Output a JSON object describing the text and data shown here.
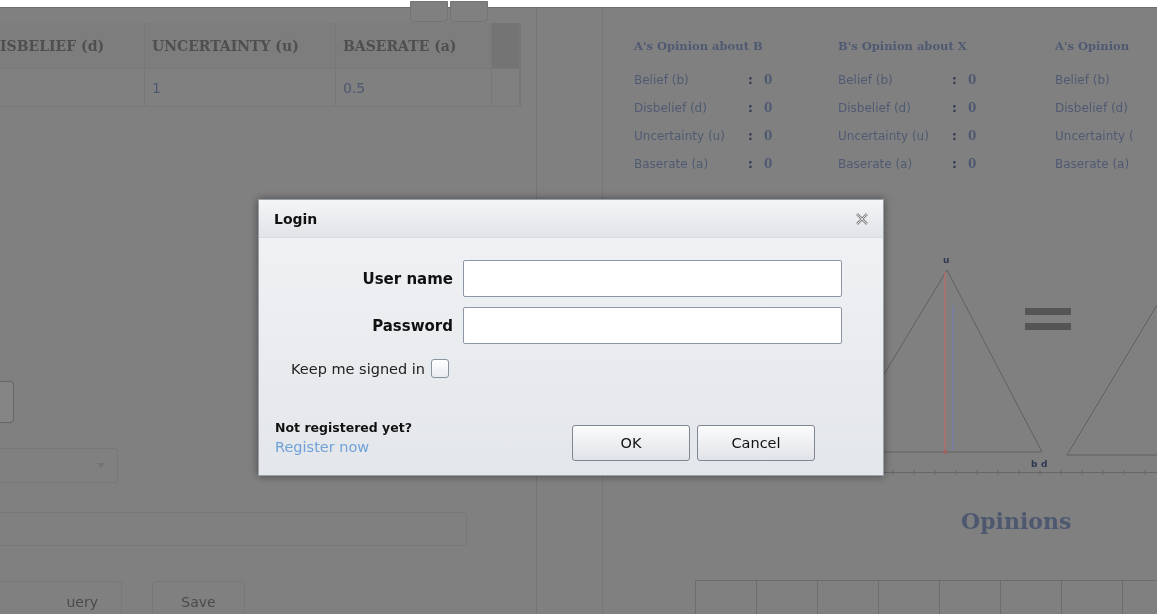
{
  "table": {
    "columns": [
      "ISBELIEF (d)",
      "UNCERTAINTY (u)",
      "BASERATE (a)"
    ],
    "rows": [
      [
        "",
        "1",
        "0.5"
      ]
    ]
  },
  "left_form": {
    "buttons": [
      "uery",
      "Save"
    ]
  },
  "opinion_cards": [
    {
      "title": "A's Opinion about B",
      "rows": [
        {
          "label": "Belief (b)",
          "separator": ":",
          "value": "0"
        },
        {
          "label": "Disbelief (d)",
          "separator": ":",
          "value": "0"
        },
        {
          "label": "Uncertainty (u)",
          "separator": ":",
          "value": "0"
        },
        {
          "label": "Baserate (a)",
          "separator": ":",
          "value": "0"
        }
      ]
    },
    {
      "title": "B's Opinion about X",
      "rows": [
        {
          "label": "Belief (b)",
          "separator": ":",
          "value": "0"
        },
        {
          "label": "Disbelief (d)",
          "separator": ":",
          "value": "0"
        },
        {
          "label": "Uncertainty (u)",
          "separator": ":",
          "value": "0"
        },
        {
          "label": "Baserate (a)",
          "separator": ":",
          "value": "0"
        }
      ]
    },
    {
      "title": "A's Opinion",
      "rows": [
        {
          "label": "Belief (b)"
        },
        {
          "label": "Disbelief (d)"
        },
        {
          "label": "Uncertainty ("
        },
        {
          "label": "Baserate (a)"
        }
      ]
    }
  ],
  "triangle_labels": {
    "top": "u",
    "left": "b",
    "right": "d"
  },
  "section_title": "Opinions",
  "dialog": {
    "title": "Login",
    "fields": [
      {
        "label": "User name"
      },
      {
        "label": "Password"
      }
    ],
    "keep_signed_in": {
      "label": "Keep me signed in",
      "checked": false
    },
    "register_prompt": "Not registered yet?",
    "register_link": "Register now",
    "buttons": [
      "OK",
      "Cancel"
    ]
  }
}
